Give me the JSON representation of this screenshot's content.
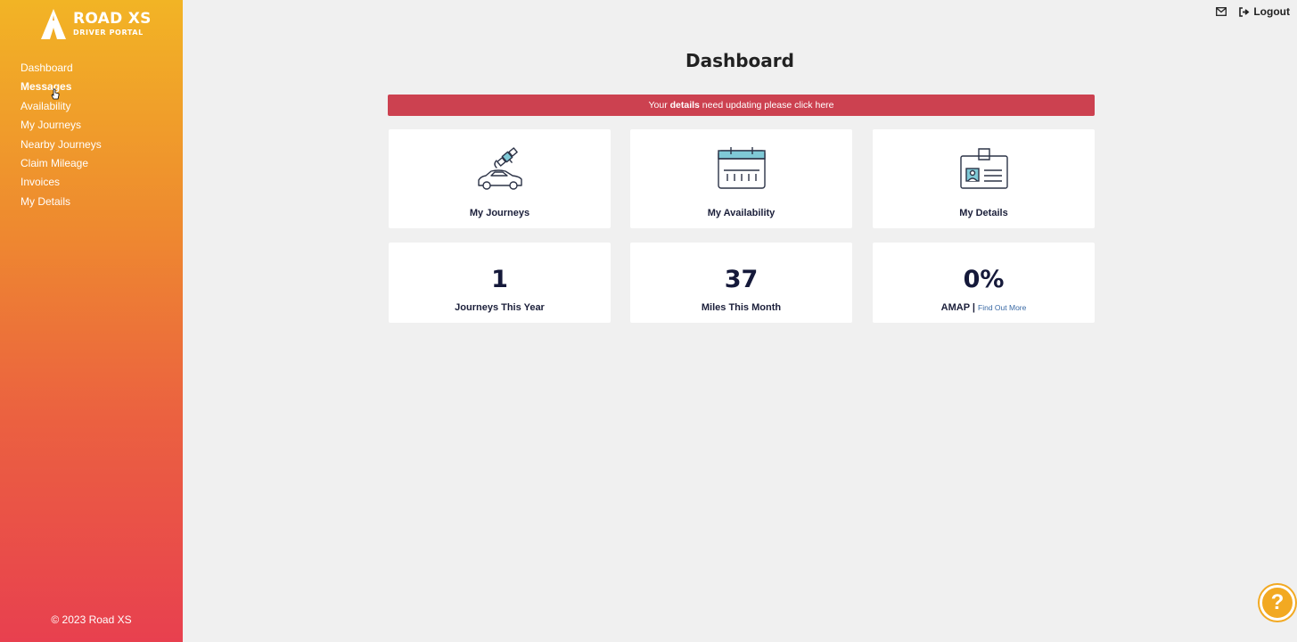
{
  "brand": {
    "title": "ROAD XS",
    "subtitle": "DRIVER PORTAL"
  },
  "sidebar": {
    "items": [
      {
        "label": "Dashboard"
      },
      {
        "label": "Messages"
      },
      {
        "label": "Availability"
      },
      {
        "label": "My Journeys"
      },
      {
        "label": "Nearby Journeys"
      },
      {
        "label": "Claim Mileage"
      },
      {
        "label": "Invoices"
      },
      {
        "label": "My Details"
      }
    ],
    "footer": "© 2023 Road XS"
  },
  "topbar": {
    "logout_label": "Logout"
  },
  "page": {
    "title": "Dashboard"
  },
  "alert": {
    "prefix": "Your ",
    "bold": "details",
    "suffix": " need updating please click here"
  },
  "cards": [
    {
      "label": "My Journeys",
      "icon": "satellite-car-icon"
    },
    {
      "label": "My Availability",
      "icon": "calendar-icon"
    },
    {
      "label": "My Details",
      "icon": "id-badge-icon"
    }
  ],
  "stats": [
    {
      "value": "1",
      "label": "Journeys This Year"
    },
    {
      "value": "37",
      "label": "Miles This Month"
    },
    {
      "value": "0%",
      "label": "AMAP |",
      "link": "Find Out More"
    }
  ],
  "help": {
    "label": "?"
  },
  "colors": {
    "gradient_top": "#f2b425",
    "gradient_bottom": "#e8404f",
    "alert": "#cc4150",
    "help": "#f2a922"
  }
}
